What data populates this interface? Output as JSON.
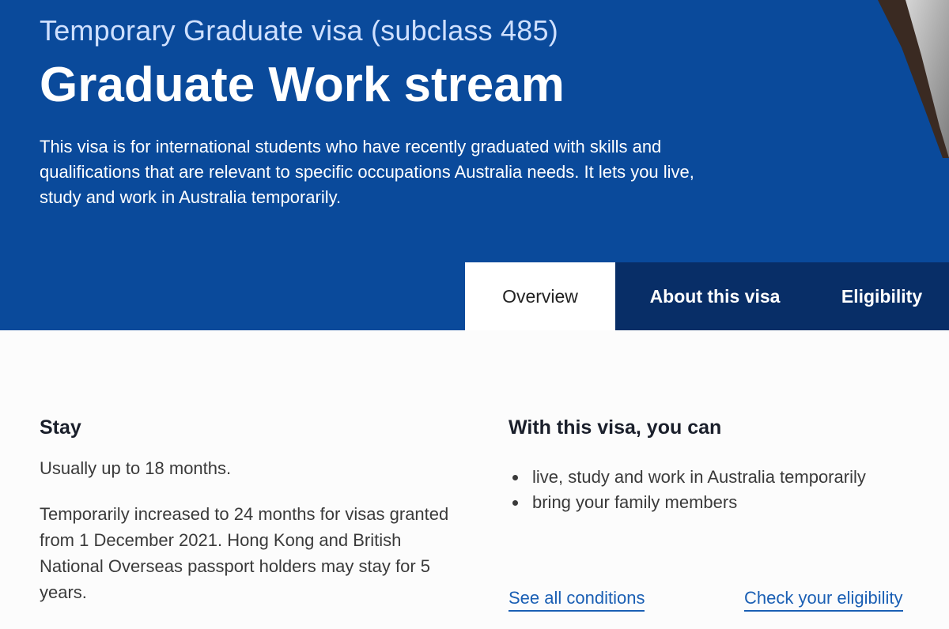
{
  "hero": {
    "subtitle": "Temporary Graduate visa (subclass 485)",
    "title": "Graduate Work stream",
    "intro": "This visa is for international students who have recently graduated with skills and qualifications that are relevant to specific occupations Australia needs. It lets you live, study and work in Australia temporarily."
  },
  "tabs": [
    {
      "label": "Overview",
      "active": true
    },
    {
      "label": "About this visa",
      "active": false
    },
    {
      "label": "Eligibility",
      "active": false
    }
  ],
  "stay": {
    "heading": "Stay",
    "p1": "Usually up to 18 months.",
    "p2": "Temporarily increased to 24 months for visas granted from 1 December 2021. Hong Kong and British National Overseas passport holders may stay for 5 years."
  },
  "can": {
    "heading": "With this visa, you can",
    "items": [
      "live, study and work in Australia temporarily",
      "bring your family members"
    ]
  },
  "links": {
    "conditions": "See all conditions",
    "eligibility": "Check your eligibility"
  },
  "colors": {
    "hero_bg": "#0a4a9b",
    "tab_dark": "#082e67",
    "link": "#1a5fb4"
  }
}
